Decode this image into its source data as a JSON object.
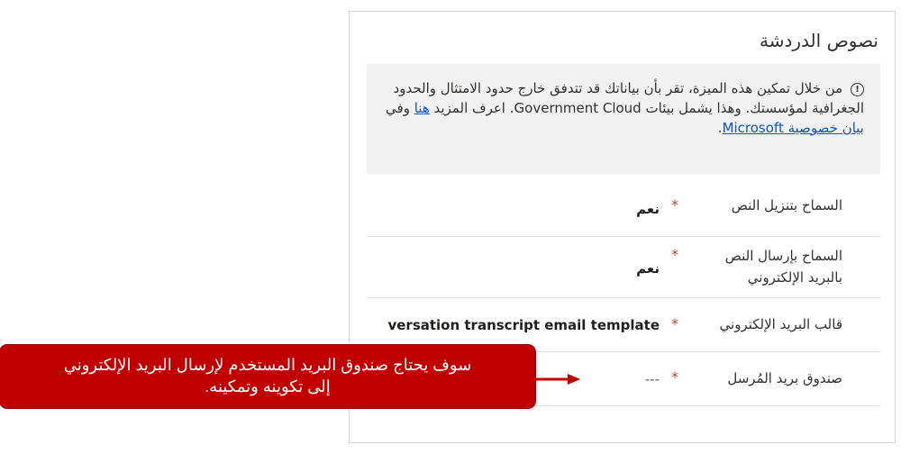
{
  "panel": {
    "title": "نصوص الدردشة",
    "notice": {
      "info_icon": "info-icon",
      "text_part1": "من خلال تمكين هذه الميزة، تقر بأن بياناتك قد تتدفق خارج حدود الامتثال والحدود الجغرافية لمؤسستك. وهذا يشمل بيئات",
      "text_part2": "Government Cloud.",
      "text_part3": "اعرف المزيد",
      "link_here": "هنا",
      "text_part4": "وفي",
      "link_privacy": "بيان خصوصية Microsoft",
      "text_end": "."
    },
    "fields": [
      {
        "label": "السماح بتنزيل النص",
        "required": "*",
        "value": "نعم"
      },
      {
        "label": "السماح بإرسال النص بالبريد الإلكتروني",
        "required": "*",
        "value": "نعم"
      },
      {
        "label": "قالب البريد الإلكتروني",
        "required": "*",
        "value": "versation transcript email template"
      },
      {
        "label": "صندوق بريد المُرسل",
        "required": "*",
        "value": "---"
      }
    ]
  },
  "callout": {
    "line1": "سوف يحتاج صندوق البريد المستخدم لإرسال البريد الإلكتروني",
    "line2": "إلى تكوينه وتمكينه.",
    "color": "#c00000"
  }
}
